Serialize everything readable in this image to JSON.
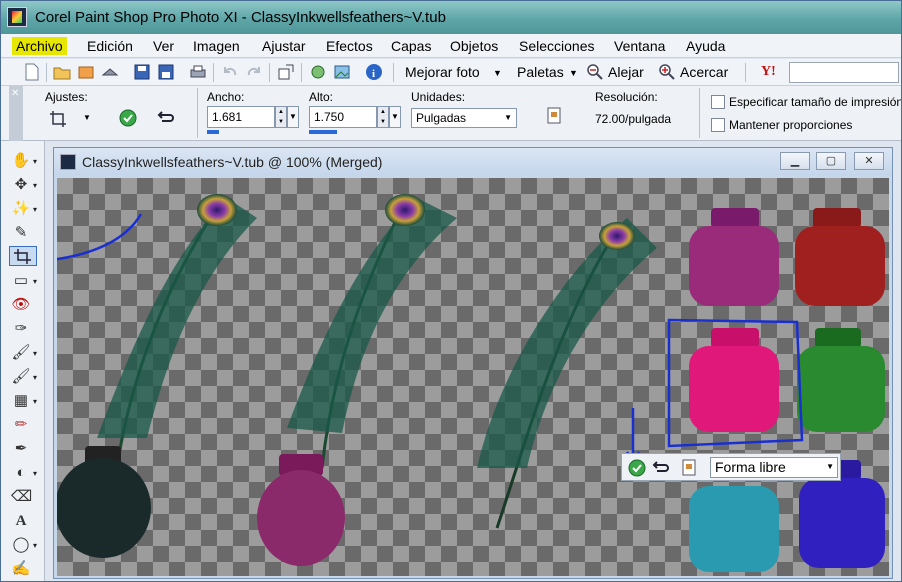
{
  "app": {
    "title": "Corel Paint Shop Pro Photo XI - ClassyInkwellsfeathers~V.tub"
  },
  "menu": {
    "items": [
      {
        "label": "Archivo"
      },
      {
        "label": "Edición"
      },
      {
        "label": "Ver"
      },
      {
        "label": "Imagen"
      },
      {
        "label": "Ajustar"
      },
      {
        "label": "Efectos"
      },
      {
        "label": "Capas"
      },
      {
        "label": "Objetos"
      },
      {
        "label": "Selecciones"
      },
      {
        "label": "Ventana"
      },
      {
        "label": "Ayuda"
      }
    ]
  },
  "toolbar": {
    "enhance_label": "Mejorar foto",
    "palettes_label": "Paletas",
    "zoom_out_label": "Alejar",
    "zoom_in_label": "Acercar",
    "brand_icon_text": "Y!"
  },
  "options": {
    "presets_label": "Ajustes:",
    "width_label": "Ancho:",
    "width_value": "1.681",
    "height_label": "Alto:",
    "height_value": "1.750",
    "units_label": "Unidades:",
    "units_value": "Pulgadas",
    "resolution_label": "Resolución:",
    "resolution_value": "72.00/pulgada",
    "specify_size_label": "Especificar tamaño de impresión",
    "keep_ratio_label": "Mantener proporciones"
  },
  "document": {
    "title": "ClassyInkwellsfeathers~V.tub @ 100% (Merged)"
  },
  "crop_toolbar": {
    "mode_value": "Forma libre"
  },
  "colors": {
    "title_bar": "#5fa6a9",
    "menu_highlight": "#e6e600",
    "annotation_blue": "#1a2fd0"
  }
}
